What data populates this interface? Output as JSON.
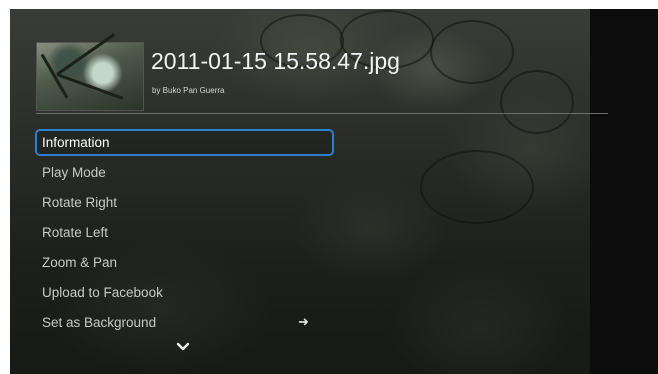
{
  "header": {
    "file_name": "2011-01-15 15.58.47.jpg",
    "byline": "by Buko Pan Guerra"
  },
  "menu": {
    "items": [
      {
        "label": "Information",
        "selected": true
      },
      {
        "label": "Play Mode"
      },
      {
        "label": "Rotate Right"
      },
      {
        "label": "Rotate Left"
      },
      {
        "label": "Zoom & Pan"
      },
      {
        "label": "Upload to Facebook"
      },
      {
        "label": "Set as Background"
      }
    ],
    "submenu_indicator": "➜"
  },
  "colors": {
    "selection_border": "#2d7fd0",
    "text_primary": "#ffffff",
    "text_secondary": "#c9c9c9"
  },
  "icons": {
    "submenu": "right-arrow-icon",
    "scroll_more": "chevron-down-icon"
  }
}
